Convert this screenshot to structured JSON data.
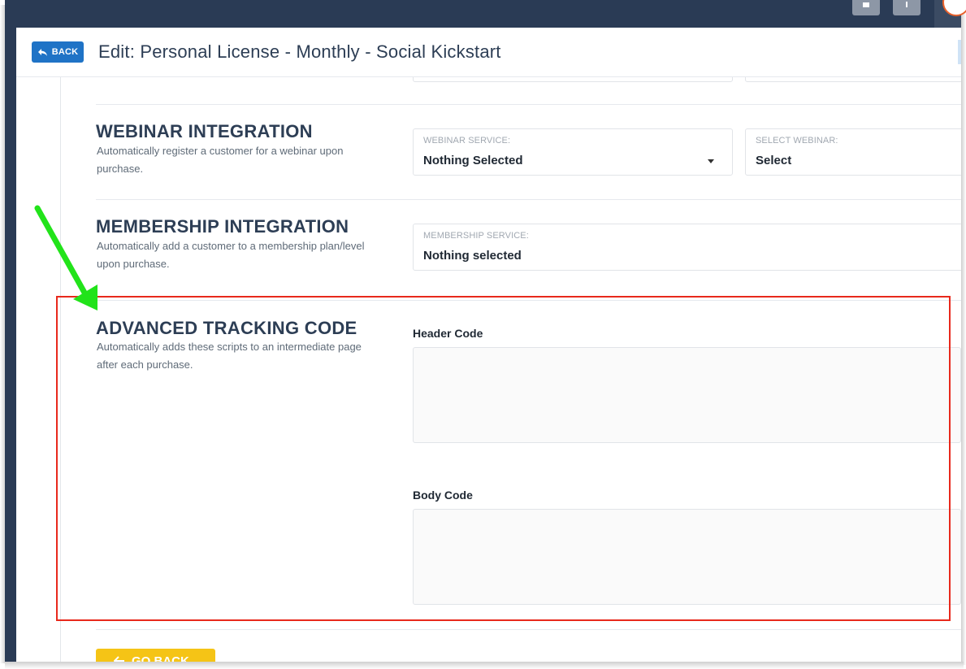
{
  "header": {
    "back_label": "BACK",
    "title": "Edit: Personal License - Monthly - Social Kickstart"
  },
  "webinar": {
    "title": "WEBINAR INTEGRATION",
    "description": "Automatically register a customer for a webinar upon purchase.",
    "service_label": "WEBINAR SERVICE:",
    "service_value": "Nothing Selected",
    "select_label": "SELECT WEBINAR:",
    "select_value": "Select"
  },
  "membership": {
    "title": "MEMBERSHIP INTEGRATION",
    "description": "Automatically add a customer to a membership plan/level upon purchase.",
    "service_label": "MEMBERSHIP SERVICE:",
    "service_value": "Nothing selected"
  },
  "tracking": {
    "title": "ADVANCED TRACKING CODE",
    "description": "Automatically adds these scripts to an intermediate page after each purchase.",
    "header_code_label": "Header Code",
    "header_code_value": "",
    "body_code_label": "Body Code",
    "body_code_value": ""
  },
  "footer": {
    "go_back_label": "GO BACK"
  },
  "colors": {
    "frame": "#2a3b55",
    "back_button": "#1f73c6",
    "go_back_button": "#f5c416",
    "highlight": "#e8291c",
    "arrow": "#22e31a"
  }
}
